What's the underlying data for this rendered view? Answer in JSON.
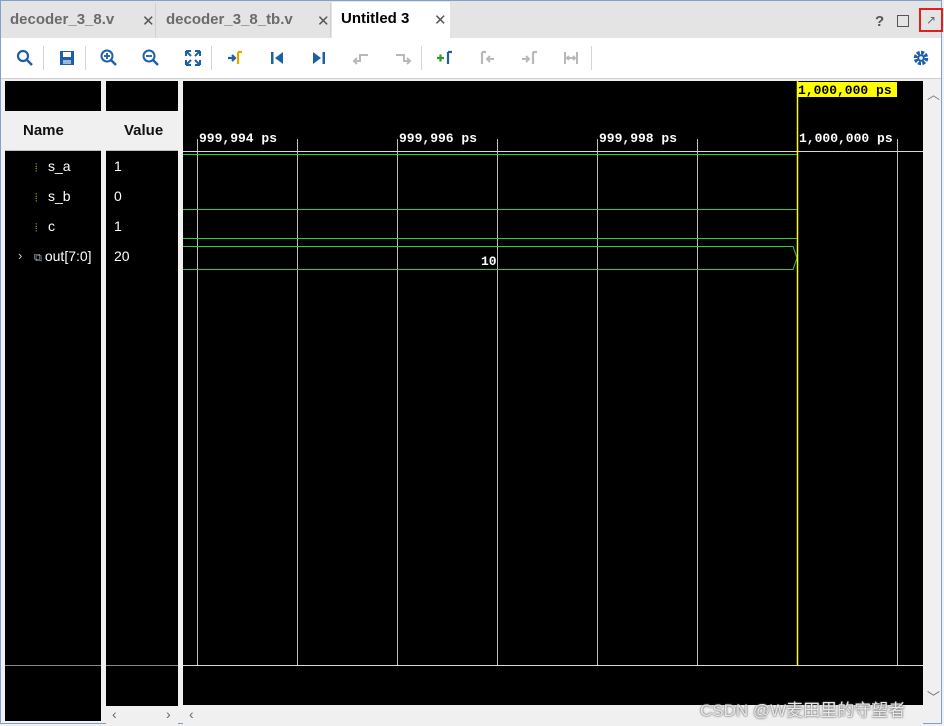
{
  "tabs": [
    {
      "label": "decoder_3_8.v",
      "close": "✕"
    },
    {
      "label": "decoder_3_8_tb.v",
      "close": "✕"
    },
    {
      "label": "Untitled 3",
      "close": "✕"
    }
  ],
  "window_buttons": {
    "help": "?",
    "restore_icon": "restore-icon",
    "float_icon": "float-window-icon"
  },
  "toolbar": {
    "buttons": [
      {
        "name": "search-icon",
        "glyph": "⌕",
        "enabled": true
      },
      {
        "name": "save-icon",
        "glyph": "▣",
        "enabled": true
      },
      {
        "name": "zoom-in-icon",
        "glyph": "⊕",
        "enabled": true
      },
      {
        "name": "zoom-out-icon",
        "glyph": "⊖",
        "enabled": true
      },
      {
        "name": "zoom-fit-icon",
        "glyph": "⤧",
        "enabled": true
      },
      {
        "name": "goto-cursor-icon",
        "glyph": "➡",
        "enabled": true
      },
      {
        "name": "goto-start-icon",
        "glyph": "⏮",
        "enabled": true
      },
      {
        "name": "goto-end-icon",
        "glyph": "⏭",
        "enabled": true
      },
      {
        "name": "prev-transition-icon",
        "glyph": "⇤",
        "enabled": false
      },
      {
        "name": "next-transition-icon",
        "glyph": "⇥",
        "enabled": false
      },
      {
        "name": "add-marker-icon",
        "glyph": "+",
        "enabled": true
      },
      {
        "name": "prev-marker-icon",
        "glyph": "⇐",
        "enabled": false
      },
      {
        "name": "next-marker-icon",
        "glyph": "⇒",
        "enabled": false
      },
      {
        "name": "swap-cursors-icon",
        "glyph": "⇔",
        "enabled": false
      },
      {
        "name": "settings-gear-icon",
        "glyph": "⚙",
        "enabled": true
      }
    ]
  },
  "columns": {
    "name": "Name",
    "value": "Value"
  },
  "signals": [
    {
      "name": "s_a",
      "value": "1",
      "type": "bit"
    },
    {
      "name": "s_b",
      "value": "0",
      "type": "bit"
    },
    {
      "name": "c",
      "value": "1",
      "type": "bit"
    },
    {
      "name": "out[7:0]",
      "value": "20",
      "type": "bus"
    }
  ],
  "timeline": {
    "ticks": [
      "999,994 ps",
      "999,996 ps",
      "999,998 ps",
      "1,000,000 ps"
    ],
    "cursor_label": "1,000,000 ps",
    "bus_value": "10"
  },
  "colors": {
    "wave": "#33cc33",
    "cursor": "#ffff00",
    "grid": "#d0d0d0",
    "background": "#000000"
  },
  "watermark": "CSDN @W麦田里的守望者"
}
